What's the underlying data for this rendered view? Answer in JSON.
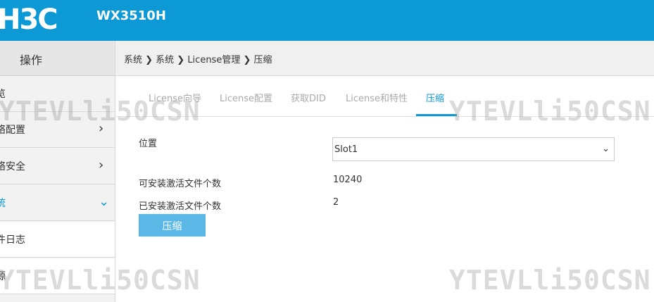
{
  "header": {
    "logo_text": "H3C",
    "model": "WX3510H"
  },
  "sidebar": {
    "title": "操作",
    "items": [
      {
        "label": "览",
        "chevron": ""
      },
      {
        "label": "络配置",
        "chevron": "›"
      },
      {
        "label": "络安全",
        "chevron": "›"
      },
      {
        "label": "统",
        "chevron": "⌄"
      },
      {
        "label": "件日志",
        "chevron": ""
      },
      {
        "label": "源",
        "chevron": ""
      }
    ]
  },
  "breadcrumb": "系统 ❯ 系统 ❯ License管理 ❯ 压缩",
  "tabs": [
    {
      "label": "License向导"
    },
    {
      "label": "License配置"
    },
    {
      "label": "获取DID"
    },
    {
      "label": "License和特性"
    },
    {
      "label": "压缩"
    }
  ],
  "form": {
    "location_label": "位置",
    "location_value": "Slot1",
    "installable_label": "可安装激活文件个数",
    "installable_value": "10240",
    "installed_label": "已安装激活文件个数",
    "installed_value": "2",
    "compress_button": "压缩"
  },
  "watermark": "YTEVLli50CSN",
  "icons": {
    "chevron_right": "chevron-right-icon",
    "chevron_down": "chevron-down-icon",
    "select_arrow": "chevron-down-icon"
  },
  "colors": {
    "brand": "#0d99d6",
    "button": "#5bb8e6"
  }
}
